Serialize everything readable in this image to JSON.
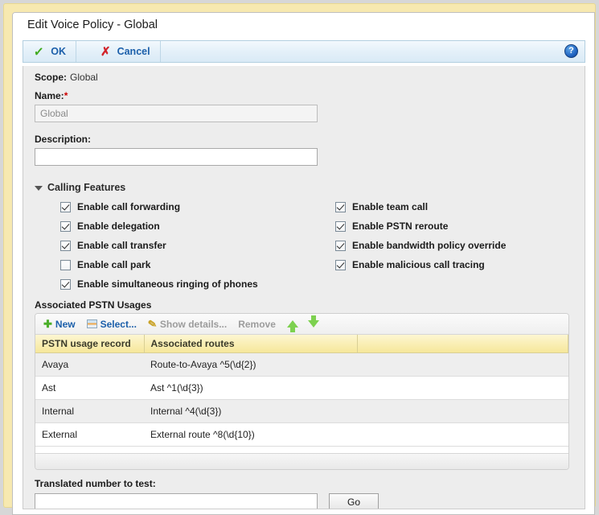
{
  "window": {
    "title": "Edit Voice Policy - Global"
  },
  "command_bar": {
    "ok_label": "OK",
    "ok_icon": "check-mark-icon",
    "cancel_label": "Cancel",
    "cancel_icon": "x-mark-icon",
    "help_icon": "help-question-icon",
    "help_glyph": "?"
  },
  "form": {
    "scope_label": "Scope:",
    "scope_value": "Global",
    "name_label": "Name:",
    "name_required_marker": "*",
    "name_value": "Global",
    "description_label": "Description:",
    "description_value": ""
  },
  "calling_features": {
    "group_title": "Calling Features",
    "left_column": [
      {
        "label": "Enable call forwarding",
        "checked": true
      },
      {
        "label": "Enable delegation",
        "checked": true
      },
      {
        "label": "Enable call transfer",
        "checked": true
      },
      {
        "label": "Enable call park",
        "checked": false
      },
      {
        "label": "Enable simultaneous ringing of phones",
        "checked": true
      }
    ],
    "right_column": [
      {
        "label": "Enable team call",
        "checked": true
      },
      {
        "label": "Enable PSTN reroute",
        "checked": true
      },
      {
        "label": "Enable bandwidth policy override",
        "checked": true
      },
      {
        "label": "Enable malicious call tracing",
        "checked": true
      }
    ]
  },
  "pstn_usages": {
    "section_title": "Associated PSTN Usages",
    "toolbar": [
      {
        "label": "New",
        "icon": "plus-icon",
        "enabled": true
      },
      {
        "label": "Select...",
        "icon": "select-table-icon",
        "enabled": true
      },
      {
        "label": "Show details...",
        "icon": "pencil-icon",
        "enabled": false
      },
      {
        "label": "Remove",
        "icon": "none",
        "enabled": false
      }
    ],
    "move_up_icon": "arrow-up-icon",
    "move_down_icon": "arrow-down-icon",
    "columns": [
      "PSTN usage record",
      "Associated routes",
      ""
    ],
    "rows": [
      [
        "Avaya",
        "Route-to-Avaya ^5(\\d{2})",
        ""
      ],
      [
        "Ast",
        "Ast ^1(\\d{3})",
        ""
      ],
      [
        "Internal",
        "Internal ^4(\\d{3})",
        ""
      ],
      [
        "External",
        "External route ^8(\\d{10})",
        ""
      ]
    ]
  },
  "translated_number": {
    "label": "Translated number to test:",
    "value": "",
    "go_label": "Go"
  },
  "colors": {
    "accent_link": "#1b5faa",
    "required_star": "#cc0000",
    "grid_header": "#f6e79a",
    "frame": "#f7e9b0",
    "ok_check": "#3faa1e",
    "cancel_x": "#d2232a"
  }
}
